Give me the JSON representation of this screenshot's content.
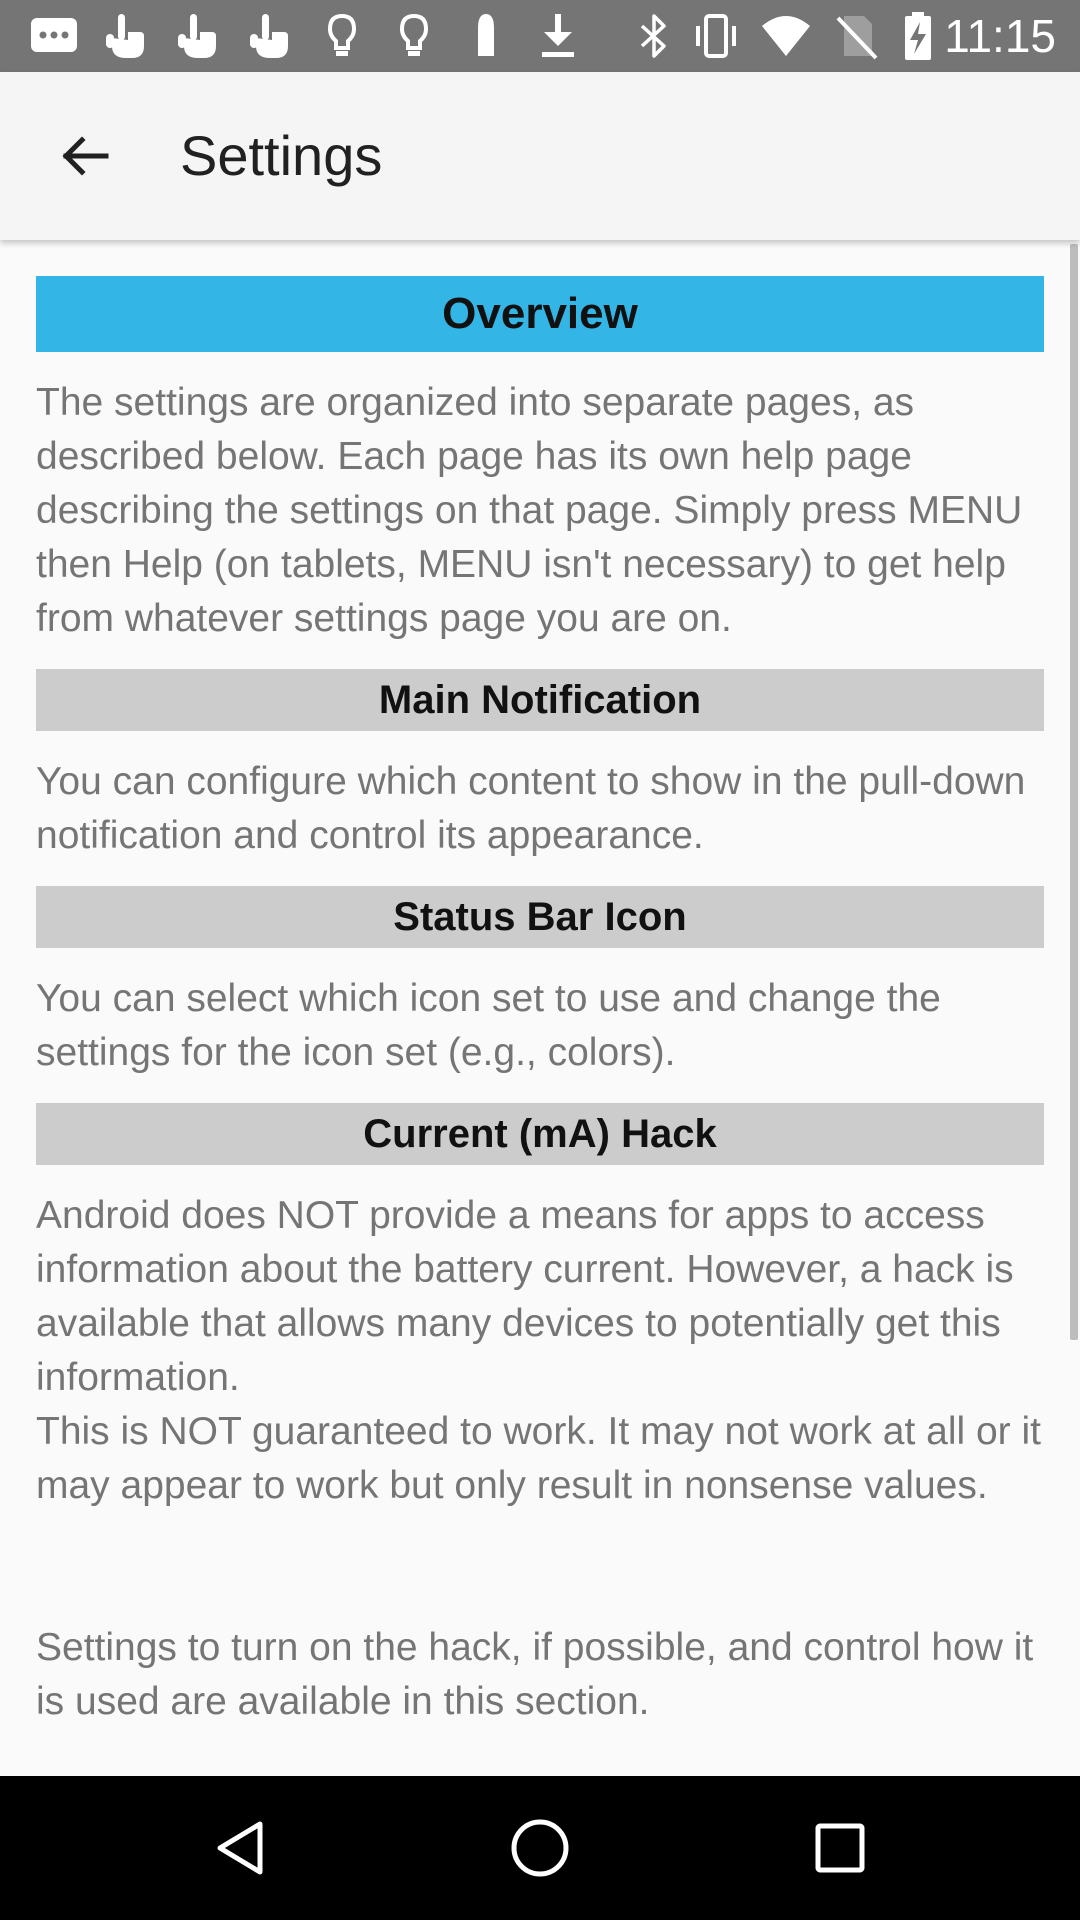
{
  "status_bar": {
    "time": "11:15",
    "icons_left": [
      "message-icon",
      "touch-icon",
      "touch-icon",
      "touch-icon",
      "lightbulb-icon",
      "lightbulb-icon",
      "bullet-icon",
      "download-icon"
    ],
    "icons_right": [
      "bluetooth-icon",
      "vibrate-icon",
      "wifi-icon",
      "no-sim-icon",
      "battery-charging-icon"
    ],
    "background": "#757575"
  },
  "app_bar": {
    "title": "Settings",
    "back_icon": "arrow-back-icon",
    "background": "#f5f5f5"
  },
  "sections": [
    {
      "header": "Overview",
      "header_color": "#33b5e5",
      "paragraphs": [
        "The settings are organized into separate pages, as described below. Each page has its own help page describing the settings on that page. Simply press MENU then Help (on tablets, MENU isn't necessary) to get help from whatever settings page you are on."
      ]
    },
    {
      "header": "Main Notification",
      "header_color": "#cccccc",
      "paragraphs": [
        "You can configure which content to show in the pull-down notification and control its appearance."
      ]
    },
    {
      "header": "Status Bar Icon",
      "header_color": "#cccccc",
      "paragraphs": [
        "You can select which icon set to use and change the settings for the icon set (e.g., colors)."
      ]
    },
    {
      "header": "Current (mA) Hack",
      "header_color": "#cccccc",
      "paragraphs": [
        "Android does NOT provide a means for apps to access information about the battery current. However, a hack is available that allows many devices to potentially get this information.",
        "This is NOT guaranteed to work. It may not work at all or it may appear to work but only result in nonsense values.",
        "Settings to turn on the hack, if possible, and control how it is used are available in this section."
      ]
    }
  ],
  "nav_bar": {
    "buttons": [
      "back-triangle-icon",
      "home-circle-icon",
      "recents-square-icon"
    ]
  }
}
